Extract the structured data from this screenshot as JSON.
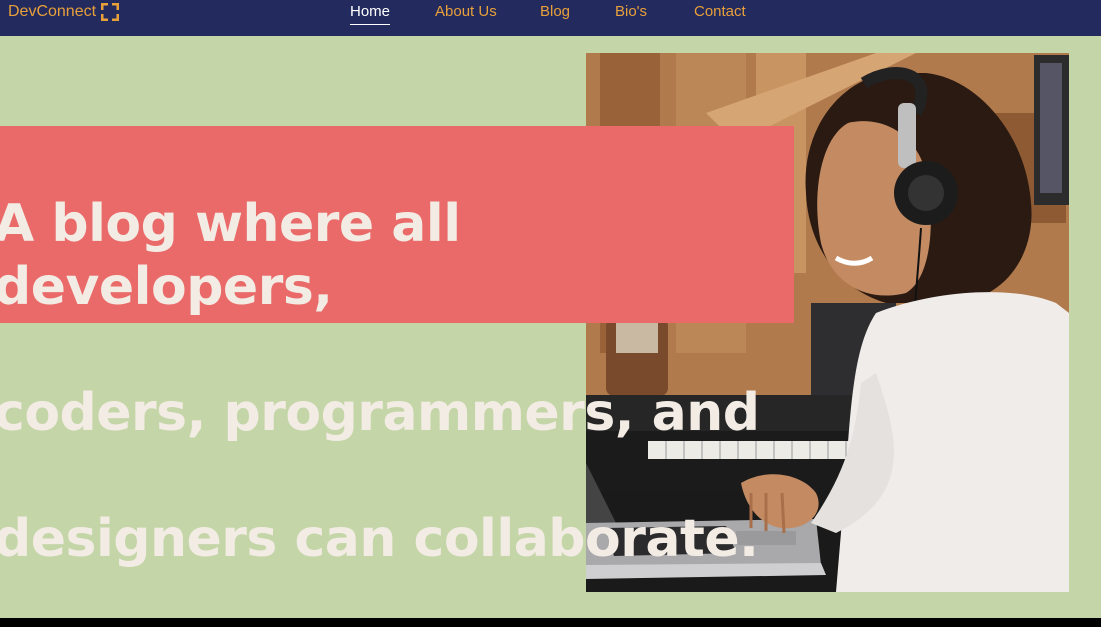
{
  "brand": {
    "name": "DevConnect",
    "icon": "bracket-frame-icon",
    "color": "#e8a03a"
  },
  "nav": {
    "items": [
      {
        "label": "Home",
        "active": true
      },
      {
        "label": "About Us",
        "active": false
      },
      {
        "label": "Blog",
        "active": false
      },
      {
        "label": "Bio's",
        "active": false
      },
      {
        "label": "Contact",
        "active": false
      }
    ]
  },
  "hero": {
    "headline_lines": [
      "A blog where all developers,",
      "coders, programmers, and",
      "designers can collaborate."
    ]
  },
  "colors": {
    "navbar": "#232a5e",
    "background": "#c4d5a8",
    "headline_box": "#e96a69",
    "headline_text": "#f3ece4",
    "link": "#e8a03a"
  }
}
